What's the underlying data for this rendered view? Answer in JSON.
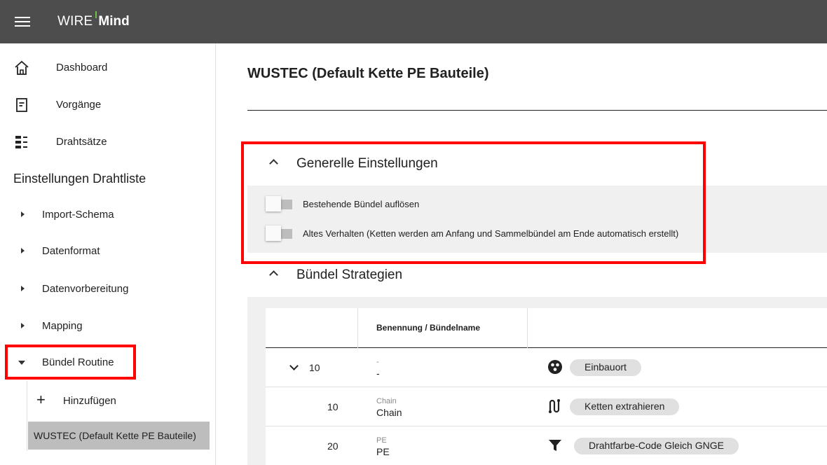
{
  "app": {
    "logo_wire": "WIRE",
    "logo_mind": "Mind",
    "accent_color": "#6cc04a",
    "topbar_color": "#4d4d4d"
  },
  "sidebar": {
    "main_items": [
      {
        "label": "Dashboard",
        "icon": "home-icon"
      },
      {
        "label": "Vorgänge",
        "icon": "document-icon"
      },
      {
        "label": "Drahtsätze",
        "icon": "list-icon"
      }
    ],
    "section_title": "Einstellungen Drahtliste",
    "sub_items": [
      {
        "label": "Import-Schema",
        "expanded": false
      },
      {
        "label": "Datenformat",
        "expanded": false
      },
      {
        "label": "Datenvorbereitung",
        "expanded": false
      },
      {
        "label": "Mapping",
        "expanded": false
      },
      {
        "label": "Bündel Routine",
        "expanded": true
      }
    ],
    "add_label": "Hinzufügen",
    "active_label": "WUSTEC (Default Kette PE Bauteile)"
  },
  "main": {
    "title": "WUSTEC (Default Kette PE Bauteile)",
    "general": {
      "heading": "Generelle Einstellungen",
      "toggles": [
        {
          "label": "Bestehende Bündel auflösen",
          "on": false
        },
        {
          "label": "Altes Verhalten (Ketten werden am Anfang und Sammelbündel am Ende automatisch erstellt)",
          "on": false
        }
      ]
    },
    "strategies": {
      "heading": "Bündel Strategien",
      "column_header": "Benennung / Bündelname",
      "rows": [
        {
          "number": "10",
          "small": "-",
          "name": "-",
          "icon": "cluster-icon",
          "chip": "Einbauort",
          "expandable": true
        },
        {
          "number": "10",
          "small": "Chain",
          "name": "Chain",
          "icon": "route-icon",
          "chip": "Ketten extrahieren",
          "expandable": false
        },
        {
          "number": "20",
          "small": "PE",
          "name": "PE",
          "icon": "filter-icon",
          "chip": "Drahtfarbe-Code  Gleich  GNGE",
          "expandable": false
        }
      ]
    }
  }
}
